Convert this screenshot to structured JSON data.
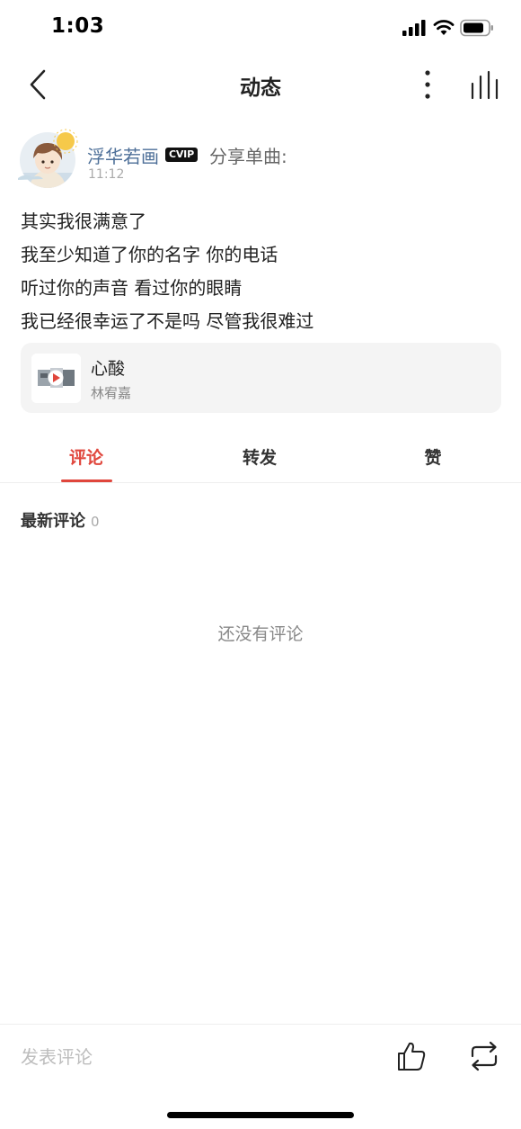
{
  "status_bar": {
    "time": "1:03"
  },
  "nav": {
    "title": "动态"
  },
  "post": {
    "username": "浮华若画",
    "vip_label": "CVIP",
    "action": "分享单曲:",
    "time": "11:12",
    "lines": [
      "其实我很满意了",
      "我至少知道了你的名字 你的电话",
      "听过你的声音 看过你的眼睛",
      "我已经很幸运了不是吗 尽管我很难过"
    ],
    "song": {
      "title": "心酸",
      "artist": "林宥嘉"
    }
  },
  "tabs": [
    {
      "label": "评论",
      "active": true
    },
    {
      "label": "转发",
      "active": false
    },
    {
      "label": "赞",
      "active": false
    }
  ],
  "comments": {
    "title": "最新评论",
    "count": "0",
    "empty_text": "还没有评论"
  },
  "bottom_bar": {
    "input_placeholder": "发表评论"
  },
  "colors": {
    "accent": "#e0463c",
    "username": "#4d6f98",
    "card_bg": "#f4f4f4"
  },
  "icons": {
    "back": "chevron-left-icon",
    "more": "more-vertical-icon",
    "now_playing": "equalizer-icon",
    "like": "thumbs-up-icon",
    "repost": "repost-icon"
  }
}
